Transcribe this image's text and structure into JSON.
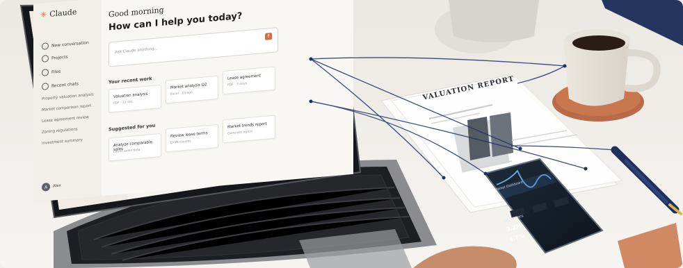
{
  "laptop_ui": {
    "brand": "Claude",
    "sidebar": {
      "items": [
        {
          "label": "New conversation"
        },
        {
          "label": "Projects"
        },
        {
          "label": "Files"
        },
        {
          "label": "Recent chats"
        }
      ],
      "recent_items": [
        {
          "label": "Property valuation analysis"
        },
        {
          "label": "Market comparison report"
        },
        {
          "label": "Lease agreement review"
        },
        {
          "label": "Zoning regulations"
        },
        {
          "label": "Investment summary"
        }
      ],
      "user": {
        "initial": "A",
        "name": "Alex"
      }
    },
    "main": {
      "greeting": "Good morning",
      "headline": "How can I help you today?",
      "input_placeholder": "Ask Claude anything...",
      "recent_work_title": "Your recent work",
      "recent_work": [
        {
          "title": "Valuation analysis",
          "subtitle": "PDF · 22 sec"
        },
        {
          "title": "Market analysis Q2",
          "subtitle": "Excel · 1h ago"
        },
        {
          "title": "Lease agreement",
          "subtitle": "PDF · 3 days"
        }
      ],
      "suggested_title": "Suggested for you",
      "suggested": [
        {
          "title": "Analyze comparable sales",
          "subtitle": "Latest sales data"
        },
        {
          "title": "Review lease terms",
          "subtitle": "Draft clauses"
        },
        {
          "title": "Market trends report",
          "subtitle": "Generate report"
        }
      ]
    }
  },
  "report": {
    "title": "VALUATION REPORT"
  },
  "phone_ui": {
    "title": "Market Dashboard",
    "kpi_title": "Key Metrics",
    "value1": "3.2M",
    "value2": "4.7%"
  },
  "colors": {
    "accent_orange": "#d46c44",
    "ui_bg": "#f8f7f4",
    "sidebar_bg": "#f2efe9",
    "navy_lines": "#1d2f63",
    "phone_bg": "#121923"
  }
}
